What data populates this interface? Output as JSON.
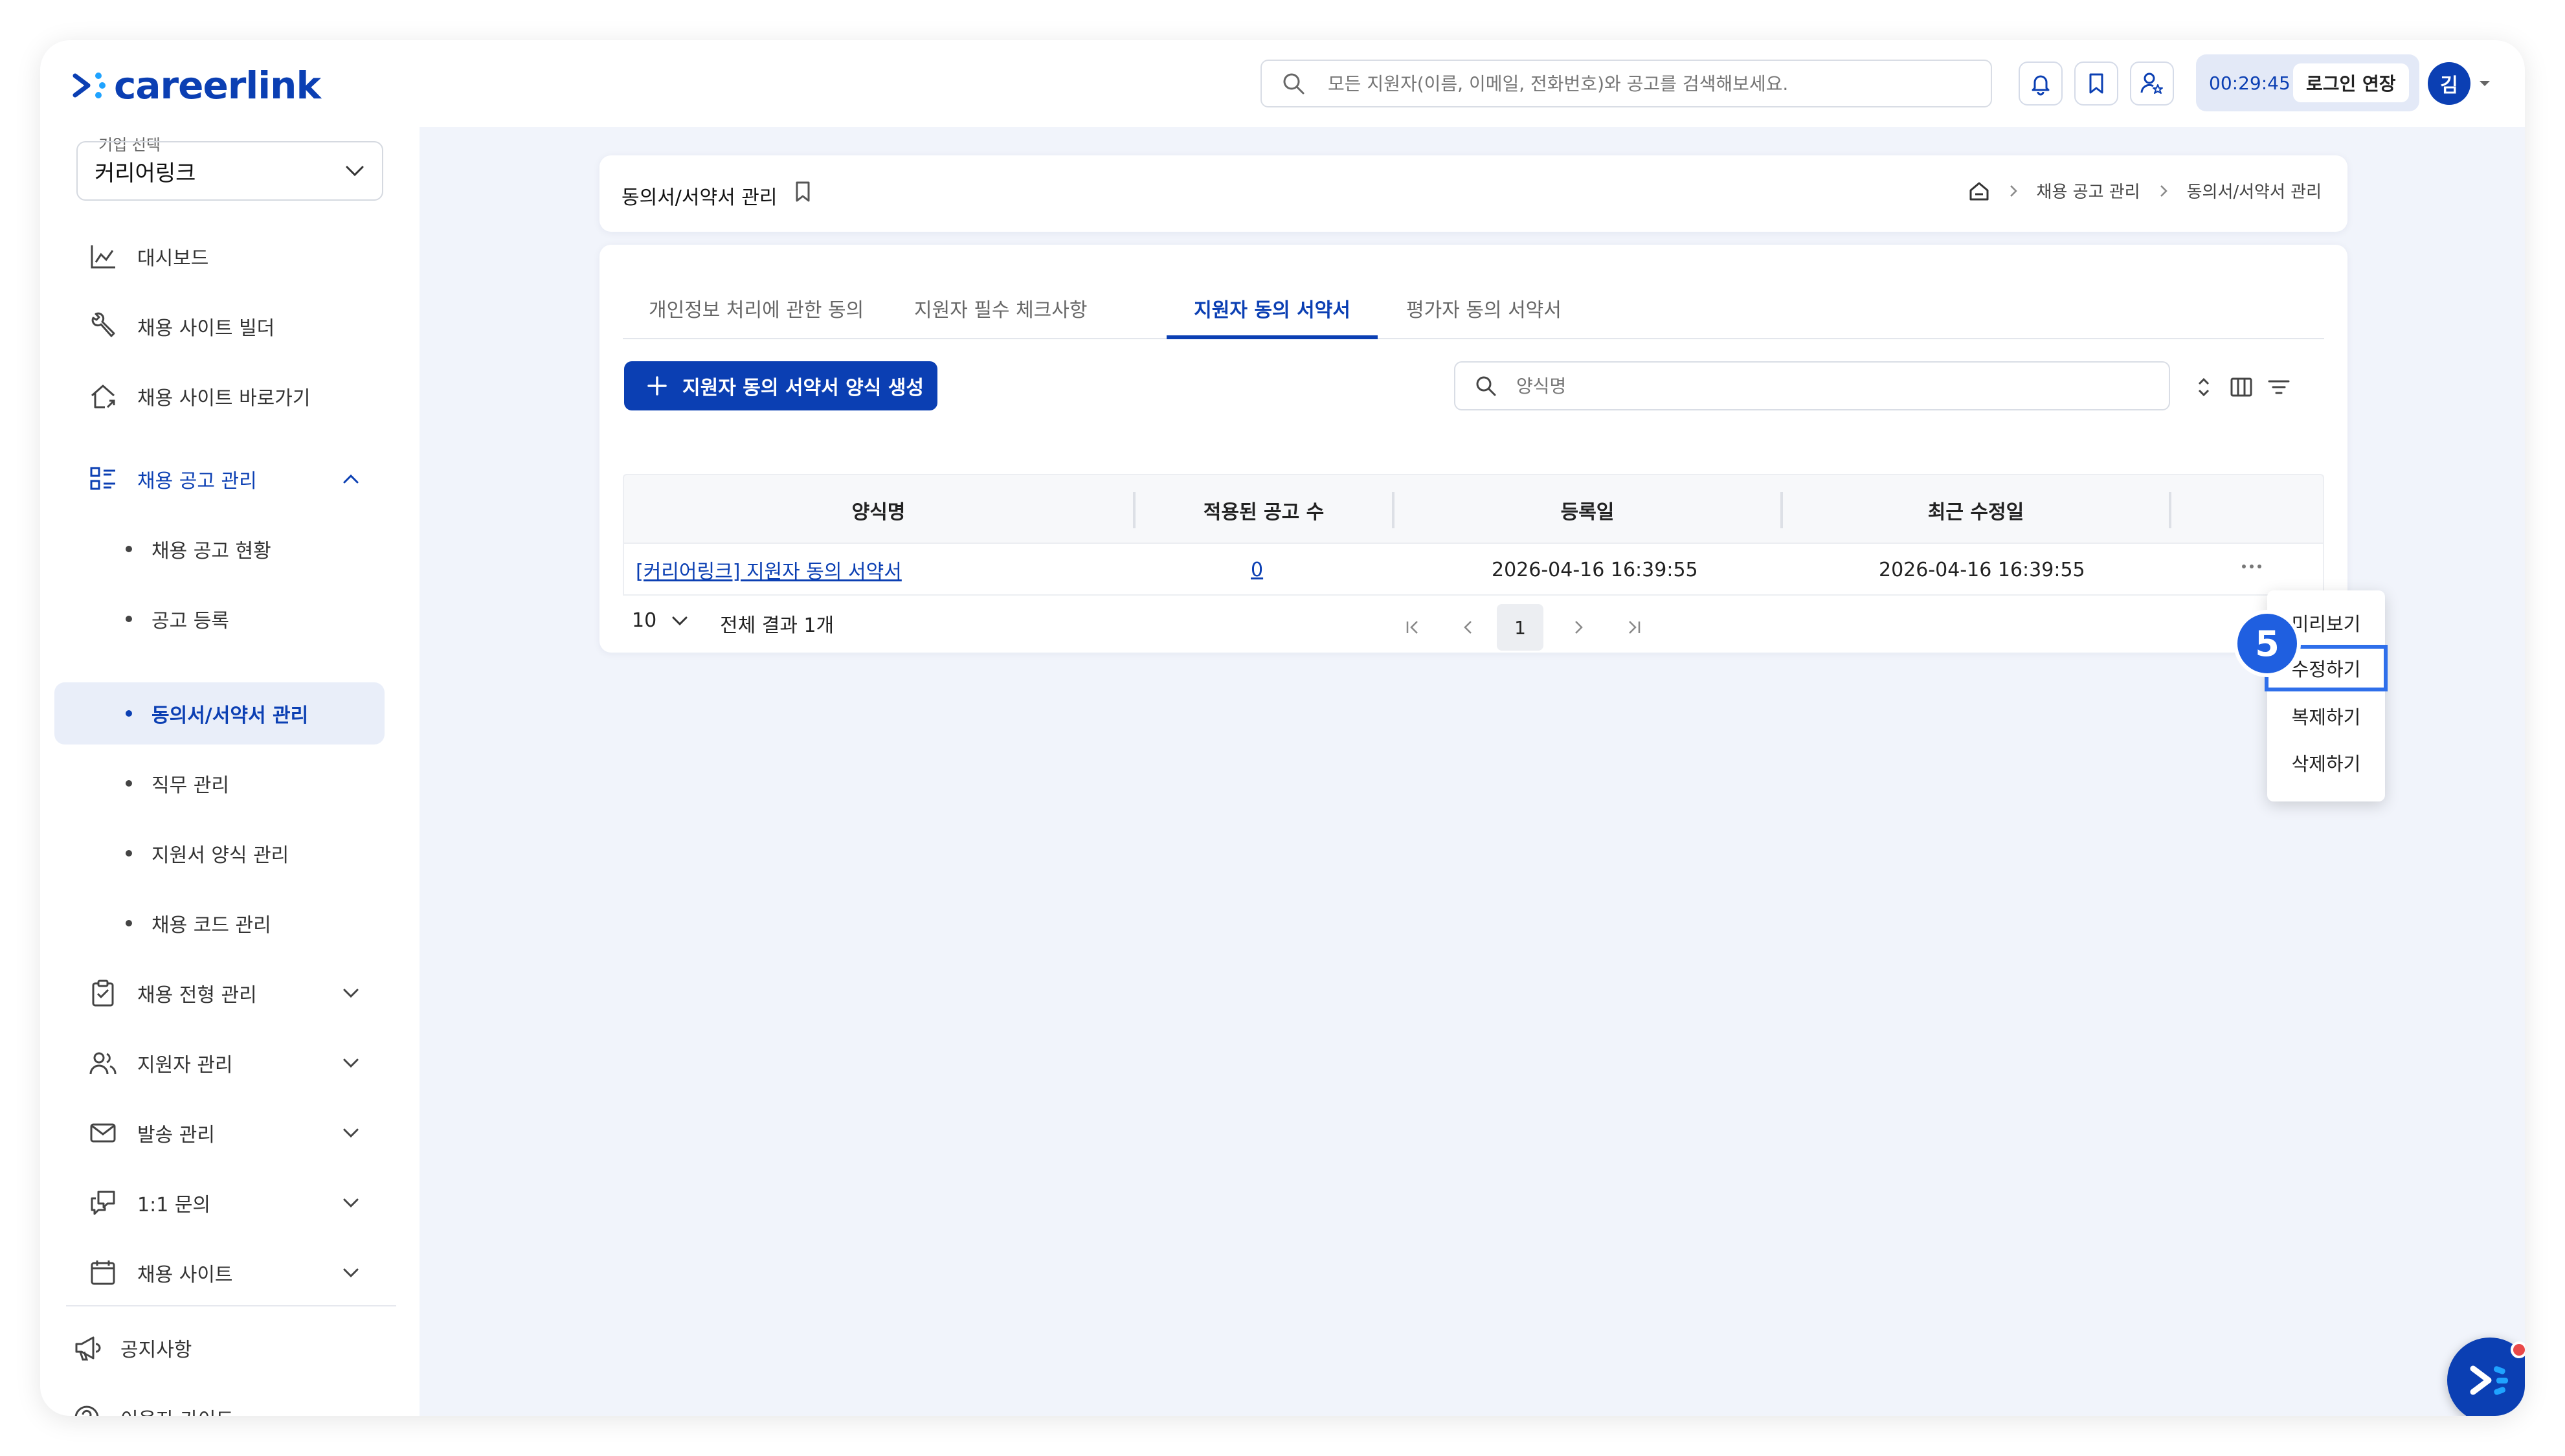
{
  "brand": {
    "name": "careerlink",
    "color": "#0b3fb3"
  },
  "header": {
    "search_placeholder": "모든 지원자(이름, 이메일, 전화번호)와 공고를 검색해보세요.",
    "timer": "00:29:45",
    "extend_label": "로그인 연장",
    "avatar_initial": "김",
    "icons": [
      "bell-icon",
      "bookmark-icon",
      "user-star-icon"
    ]
  },
  "sidebar": {
    "company_label": "기업 선택",
    "company_value": "커리어링크",
    "items": [
      {
        "label": "대시보드",
        "icon": "chart-icon"
      },
      {
        "label": "채용 사이트 빌더",
        "icon": "wrench-icon"
      },
      {
        "label": "채용 사이트 바로가기",
        "icon": "home-link-icon"
      },
      {
        "label": "채용 공고 관리",
        "icon": "list-icon"
      },
      {
        "label": "채용 전형 관리",
        "icon": "clipboard-icon"
      },
      {
        "label": "지원자 관리",
        "icon": "users-icon"
      },
      {
        "label": "발송 관리",
        "icon": "mail-icon"
      },
      {
        "label": "1:1 문의",
        "icon": "chat-icon"
      },
      {
        "label": "채용 사이트",
        "icon": "browser-icon"
      }
    ],
    "sub_items": [
      "채용 공고 현황",
      "공고 등록",
      "동의서/서약서 관리",
      "직무 관리",
      "지원서 양식 관리",
      "채용 코드 관리"
    ],
    "footer": [
      {
        "label": "공지사항",
        "icon": "megaphone-icon"
      },
      {
        "label": "이용자 가이드",
        "icon": "help-icon"
      }
    ]
  },
  "page": {
    "title": "동의서/서약서 관리",
    "breadcrumb": [
      "채용 공고 관리",
      "동의서/서약서 관리"
    ]
  },
  "tabs": [
    "개인정보 처리에 관한 동의",
    "지원자 필수 체크사항",
    "지원자 동의 서약서",
    "평가자 동의 서약서"
  ],
  "toolbar": {
    "create_label": "지원자 동의 서약서 양식 생성",
    "search_placeholder": "양식명"
  },
  "table": {
    "columns": [
      "양식명",
      "적용된 공고 수",
      "등록일",
      "최근 수정일"
    ],
    "rows": [
      {
        "name": "[커리어링크] 지원자 동의 서약서",
        "count": "0",
        "created": "2026-04-16 16:39:55",
        "modified": "2026-04-16 16:39:55"
      }
    ]
  },
  "pagination": {
    "page_size": "10",
    "total": "전체 결과 1개",
    "current_page": "1"
  },
  "row_menu": [
    "미리보기",
    "수정하기",
    "복제하기",
    "삭제하기"
  ],
  "step_badge": "5"
}
